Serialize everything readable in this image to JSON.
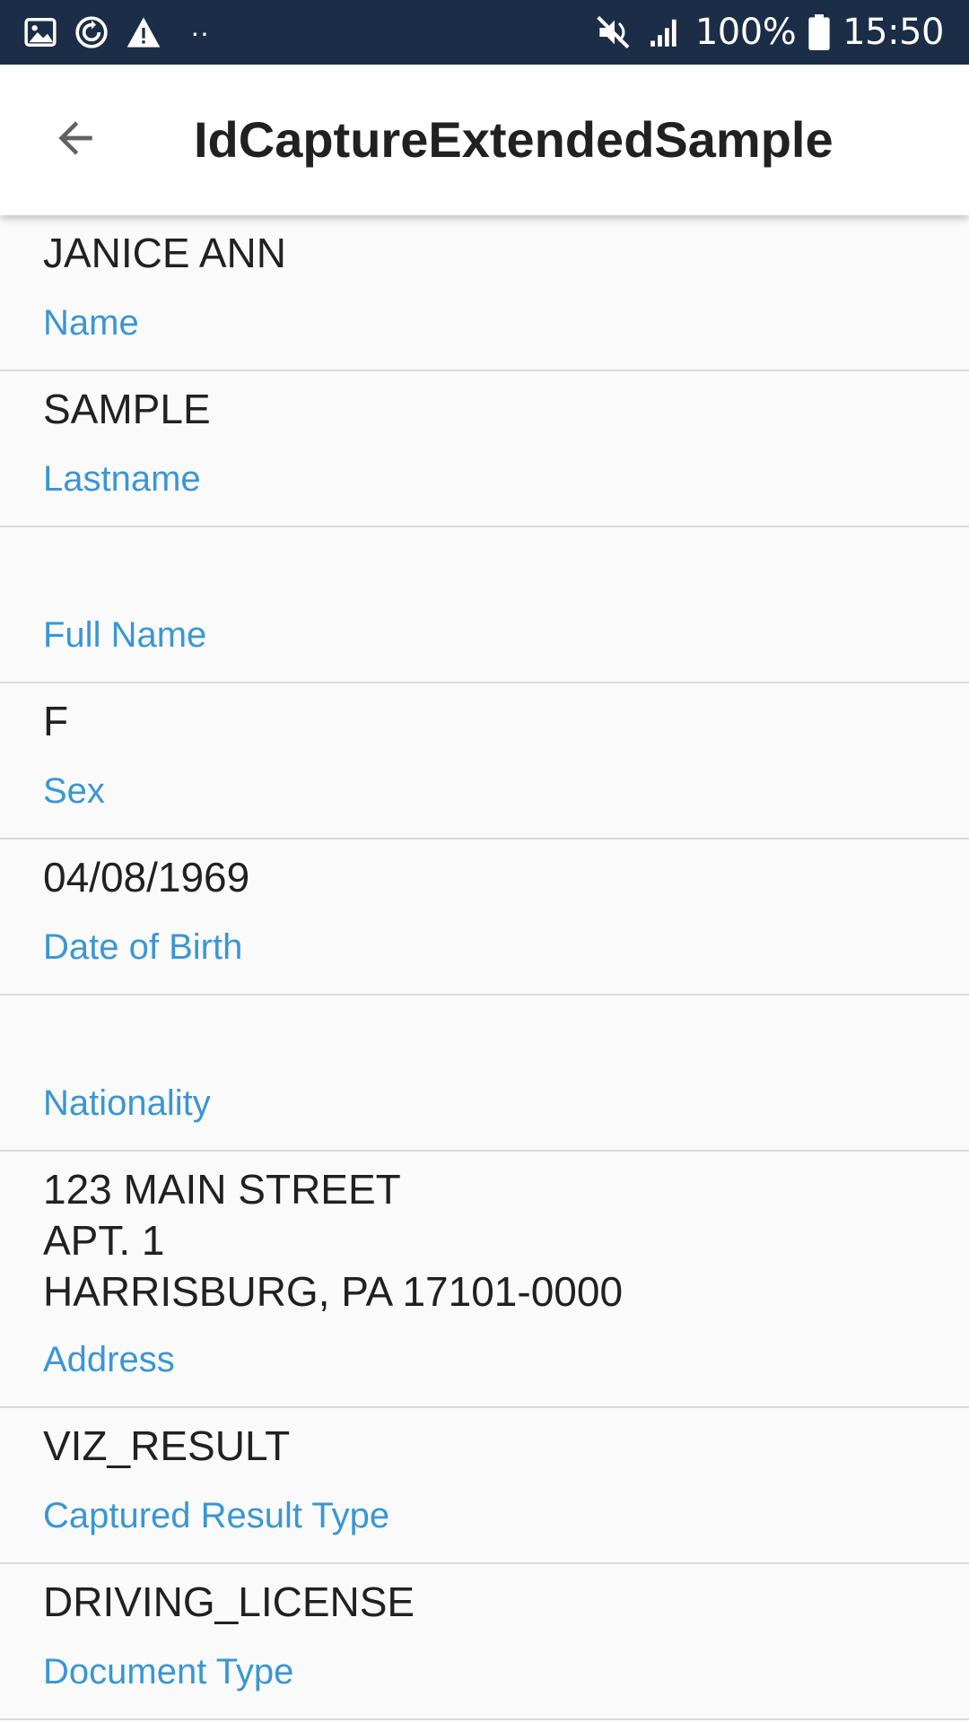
{
  "status_bar": {
    "battery": "100%",
    "time": "15:50",
    "dots": "··",
    "icons_left": [
      "image-icon",
      "sync-icon",
      "warning-icon"
    ],
    "icons_right": [
      "mute-icon",
      "signal-icon",
      "battery-icon"
    ]
  },
  "app_bar": {
    "title": "IdCaptureExtendedSample",
    "back_icon": "arrow-left-icon"
  },
  "fields": [
    {
      "value": "JANICE ANN",
      "label": "Name"
    },
    {
      "value": "SAMPLE",
      "label": "Lastname"
    },
    {
      "value": "",
      "label": "Full Name"
    },
    {
      "value": "F",
      "label": "Sex"
    },
    {
      "value": "04/08/1969",
      "label": "Date of Birth"
    },
    {
      "value": "",
      "label": "Nationality"
    },
    {
      "value": "123 MAIN STREET\nAPT. 1\nHARRISBURG, PA 17101-0000",
      "label": "Address"
    },
    {
      "value": "VIZ_RESULT",
      "label": "Captured Result Type"
    },
    {
      "value": "DRIVING_LICENSE",
      "label": "Document Type"
    }
  ],
  "colors": {
    "status_bar": "#1c2d47",
    "label": "#3a96d4",
    "value": "#212121",
    "background": "#fafafa",
    "divider": "#d9d9d9"
  }
}
